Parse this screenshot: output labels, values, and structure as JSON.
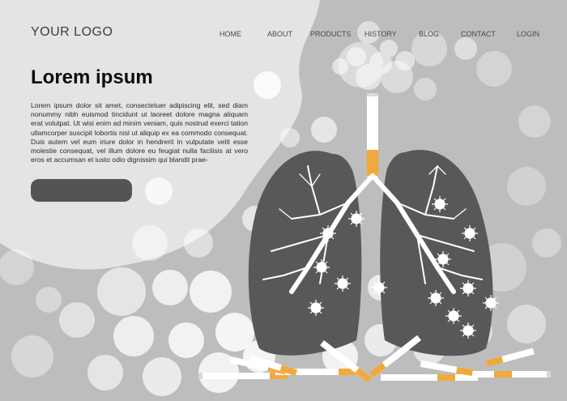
{
  "header": {
    "logo": "YOUR LOGO",
    "nav": [
      {
        "id": "home",
        "label": "HOME"
      },
      {
        "id": "about",
        "label": "ABOUT"
      },
      {
        "id": "products",
        "label": "PRODUCTS"
      },
      {
        "id": "history",
        "label": "HISTORY"
      },
      {
        "id": "blog",
        "label": "BLOG"
      },
      {
        "id": "contact",
        "label": "CONTACT"
      },
      {
        "id": "login",
        "label": "LOGIN"
      }
    ]
  },
  "hero": {
    "title": "Lorem ipsum",
    "body": "Lorem ipsum dolor sit amet, consectetuer adipiscing elit, sed diam nonummy nibh euismod tincidunt ut laoreet dolore magna aliquam erat volutpat. Ut wisi enim ad minim veniam, quis nostrud exerci tation ullamcorper suscipit lobortis nisl ut aliquip ex ea commodo consequat. Duis autem vel eum iriure dolor in hendrerit in vulputate velit esse molestie consequat, vel illum dolore eu feugiat nulla facilisis at vero eros et accumsan et iusto odio dignissim qui blandit prae-",
    "cta_label": ""
  },
  "illustration": {
    "subject": "lungs with virus particles and cigarettes",
    "colors": {
      "lung": "#585858",
      "bronchi": "#ffffff",
      "filter": "#f2a93b",
      "paper": "#ffffff",
      "background": "#bdbdbd",
      "panel": "#e3e3e3"
    }
  }
}
